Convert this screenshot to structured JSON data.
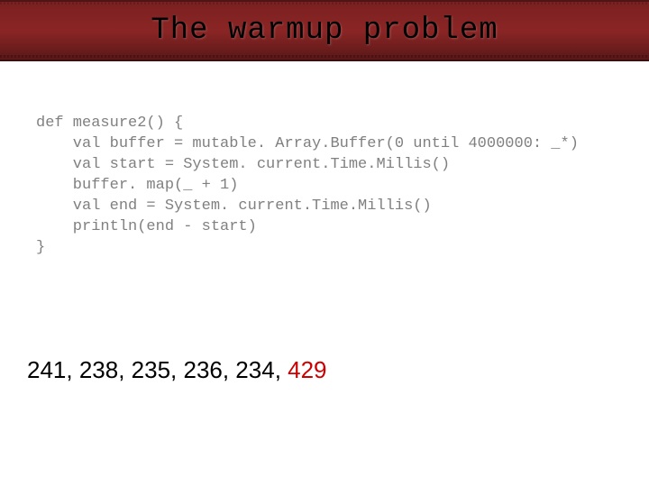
{
  "header": {
    "title": "The warmup problem"
  },
  "code": {
    "line1": "def measure2() {",
    "line2": "    val buffer = mutable. Array.Buffer(0 until 4000000: _*)",
    "line3": "    val start = System. current.Time.Millis()",
    "line4": "    buffer. map(_ + 1)",
    "line5": "    val end = System. current.Time.Millis()",
    "line6": "    println(end - start)",
    "line7": "}"
  },
  "results": {
    "normal": "241, 238, 235, 236, 234, ",
    "highlight": "429"
  }
}
